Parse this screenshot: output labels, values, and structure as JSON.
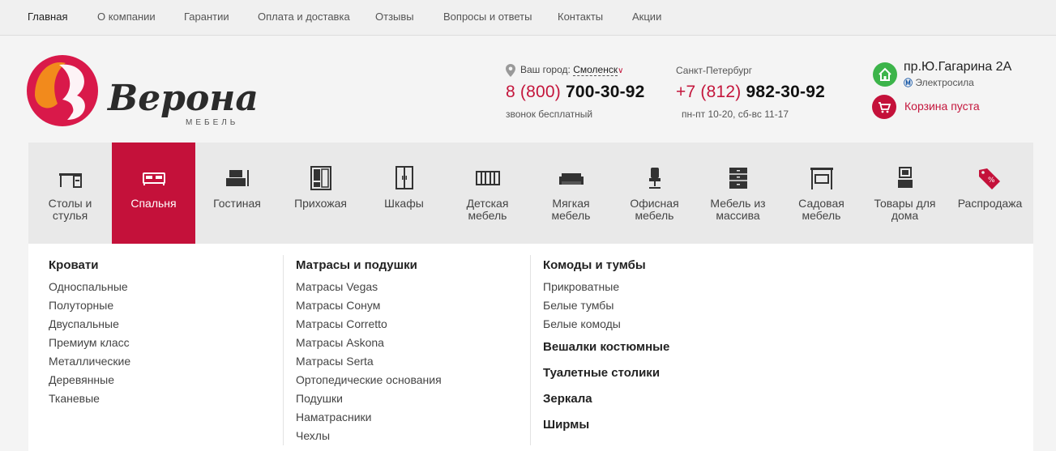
{
  "topnav": {
    "items": [
      {
        "label": "Главная"
      },
      {
        "label": "О компании"
      },
      {
        "label": "Гарантии"
      },
      {
        "label": "Оплата и доставка"
      },
      {
        "label": "Отзывы"
      },
      {
        "label": "Вопросы и ответы"
      },
      {
        "label": "Контакты"
      },
      {
        "label": "Акции"
      }
    ]
  },
  "logo": {
    "name": "Верона",
    "subtitle": "МЕБЕЛЬ"
  },
  "city": {
    "label": "Ваш город:",
    "value": "Смоленск"
  },
  "phone1": {
    "code": "8 (800)",
    "number": "700-30-92",
    "note": "звонок бесплатный"
  },
  "phone2": {
    "city": "Санкт-Петербург",
    "code": "+7 (812)",
    "number": "982-30-92",
    "hours": "пн-пт 10-20, сб-вс 11-17"
  },
  "address": {
    "street": "пр.Ю.Гагарина 2А",
    "metro": "Электросила"
  },
  "cart": {
    "label": "Корзина пуста"
  },
  "categories": [
    {
      "l1": "Столы и",
      "l2": "стулья",
      "icon": "table-icon"
    },
    {
      "l1": "Спальня",
      "l2": "",
      "icon": "bed-icon"
    },
    {
      "l1": "Гостиная",
      "l2": "",
      "icon": "tv-stand-icon"
    },
    {
      "l1": "Прихожая",
      "l2": "",
      "icon": "hallway-icon"
    },
    {
      "l1": "Шкафы",
      "l2": "",
      "icon": "wardrobe-icon"
    },
    {
      "l1": "Детская",
      "l2": "мебель",
      "icon": "crib-icon"
    },
    {
      "l1": "Мягкая",
      "l2": "мебель",
      "icon": "sofa-icon"
    },
    {
      "l1": "Офисная",
      "l2": "мебель",
      "icon": "office-chair-icon"
    },
    {
      "l1": "Мебель из",
      "l2": "массива",
      "icon": "dresser-icon"
    },
    {
      "l1": "Садовая",
      "l2": "мебель",
      "icon": "garden-swing-icon"
    },
    {
      "l1": "Товары для",
      "l2": "дома",
      "icon": "home-goods-icon"
    },
    {
      "l1": "Распродажа",
      "l2": "",
      "icon": "sale-tag-icon"
    }
  ],
  "dropdown": {
    "col1": {
      "title": "Кровати",
      "links": [
        "Односпальные",
        "Полуторные",
        "Двуспальные",
        "Премиум класс",
        "Металлические",
        "Деревянные",
        "Тканевые"
      ]
    },
    "col2": {
      "title": "Матрасы и подушки",
      "links": [
        "Матрасы Vegas",
        "Матрасы Сонум",
        "Матрасы Corretto",
        "Матрасы Askona",
        "Матрасы Serta",
        "Ортопедические основания",
        "Подушки",
        "Наматрасники",
        "Чехлы"
      ]
    },
    "col3": {
      "title": "Комоды и тумбы",
      "links": [
        "Прикроватные",
        "Белые тумбы",
        "Белые комоды"
      ],
      "extra": [
        "Вешалки костюмные",
        "Туалетные столики",
        "Зеркала",
        "Ширмы"
      ]
    }
  },
  "colors": {
    "accent": "#c4113a",
    "home_icon": "#3cb44a"
  }
}
